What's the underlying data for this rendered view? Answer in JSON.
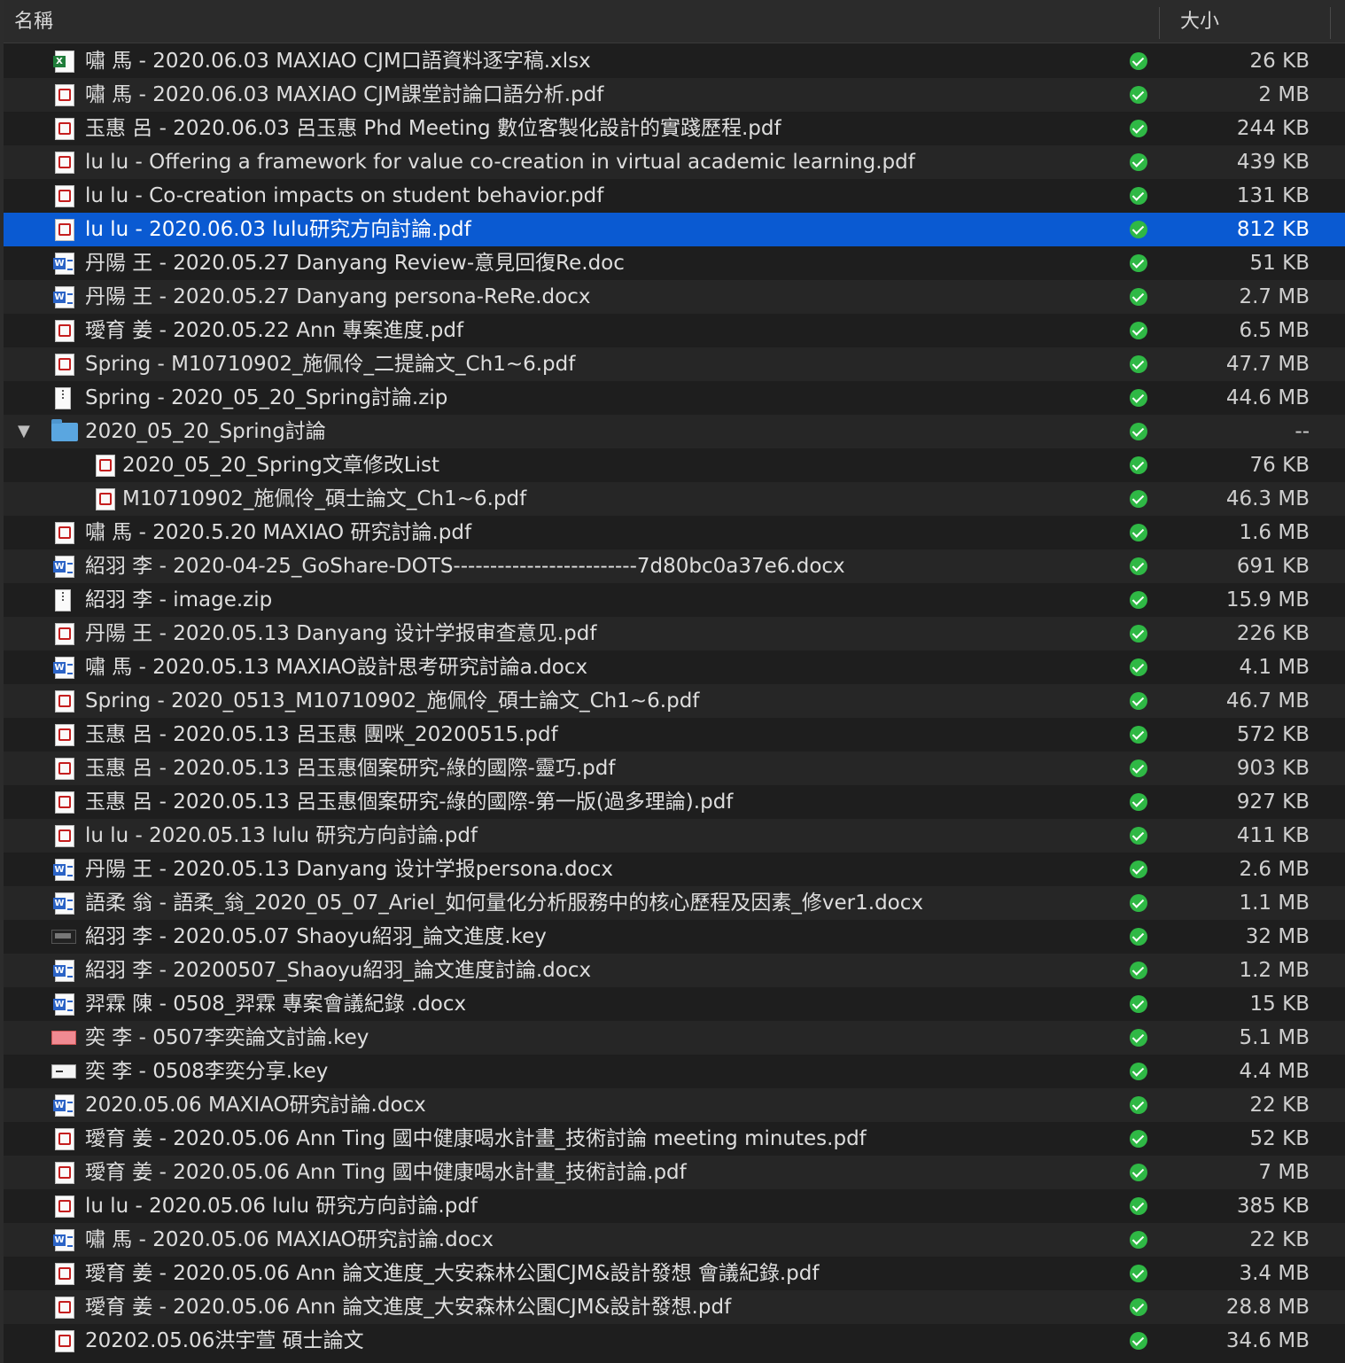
{
  "header": {
    "name_label": "名稱",
    "size_label": "大小"
  },
  "rows": [
    {
      "name": "嘯 馬 - 2020.06.03 MAXIAO CJM口語資料逐字稿.xlsx",
      "size": "26 KB",
      "icon": "xlsx-icon",
      "indent": 0
    },
    {
      "name": "嘯 馬 - 2020.06.03 MAXIAO CJM課堂討論口語分析.pdf",
      "size": "2 MB",
      "icon": "pdf-icon",
      "indent": 0
    },
    {
      "name": "玉惠 呂 - 2020.06.03 呂玉惠 Phd Meeting 數位客製化設計的實踐歷程.pdf",
      "size": "244 KB",
      "icon": "pdf-icon",
      "indent": 0
    },
    {
      "name": "lu lu - Offering a framework for value co-creation in virtual academic learning.pdf",
      "size": "439 KB",
      "icon": "pdf-icon",
      "indent": 0
    },
    {
      "name": "lu lu - Co-creation impacts on student behavior.pdf",
      "size": "131 KB",
      "icon": "pdf-icon",
      "indent": 0
    },
    {
      "name": "lu lu - 2020.06.03 lulu研究方向討論.pdf",
      "size": "812 KB",
      "icon": "pdf-icon",
      "indent": 0,
      "selected": true
    },
    {
      "name": "丹陽 王 - 2020.05.27 Danyang Review-意見回復Re.doc",
      "size": "51 KB",
      "icon": "doc-icon",
      "indent": 0
    },
    {
      "name": "丹陽 王 - 2020.05.27 Danyang persona-ReRe.docx",
      "size": "2.7 MB",
      "icon": "doc-icon",
      "indent": 0
    },
    {
      "name": "璦育 姜 - 2020.05.22 Ann 專案進度.pdf",
      "size": "6.5 MB",
      "icon": "pdf-icon",
      "indent": 0
    },
    {
      "name": "Spring  - M10710902_施佩伶_二提論文_Ch1~6.pdf",
      "size": "47.7 MB",
      "icon": "pdf-icon",
      "indent": 0
    },
    {
      "name": "Spring  - 2020_05_20_Spring討論.zip",
      "size": "44.6 MB",
      "icon": "zip-icon",
      "indent": 0
    },
    {
      "name": "2020_05_20_Spring討論",
      "size": "--",
      "icon": "folder-icon",
      "indent": 0,
      "expanded": true
    },
    {
      "name": "2020_05_20_Spring文章修改List",
      "size": "76 KB",
      "icon": "pdf-icon",
      "indent": 1
    },
    {
      "name": "M10710902_施佩伶_碩士論文_Ch1~6.pdf",
      "size": "46.3 MB",
      "icon": "pdf-icon",
      "indent": 1
    },
    {
      "name": "嘯 馬 - 2020.5.20 MAXIAO 研究討論.pdf",
      "size": "1.6 MB",
      "icon": "pdf-icon",
      "indent": 0
    },
    {
      "name": "紹羽 李 - 2020-04-25_GoShare-DOTS-------------------------7d80bc0a37e6.docx",
      "size": "691 KB",
      "icon": "doc-icon",
      "indent": 0
    },
    {
      "name": "紹羽 李 - image.zip",
      "size": "15.9 MB",
      "icon": "zip-icon",
      "indent": 0
    },
    {
      "name": "丹陽 王 - 2020.05.13 Danyang 设计学报审查意见.pdf",
      "size": "226 KB",
      "icon": "pdf-icon",
      "indent": 0
    },
    {
      "name": "嘯 馬 - 2020.05.13 MAXIAO設計思考研究討論a.docx",
      "size": "4.1 MB",
      "icon": "doc-icon",
      "indent": 0
    },
    {
      "name": "Spring  - 2020_0513_M10710902_施佩伶_碩士論文_Ch1~6.pdf",
      "size": "46.7 MB",
      "icon": "pdf-icon",
      "indent": 0
    },
    {
      "name": "玉惠 呂 - 2020.05.13 呂玉惠 團咪_20200515.pdf",
      "size": "572 KB",
      "icon": "pdf-icon",
      "indent": 0
    },
    {
      "name": "玉惠 呂 - 2020.05.13 呂玉惠個案研究-綠的國際-靈巧.pdf",
      "size": "903 KB",
      "icon": "pdf-icon",
      "indent": 0
    },
    {
      "name": "玉惠 呂 - 2020.05.13 呂玉惠個案研究-綠的國際-第一版(過多理論).pdf",
      "size": "927 KB",
      "icon": "pdf-icon",
      "indent": 0
    },
    {
      "name": "lu lu - 2020.05.13 lulu 研究方向討論.pdf",
      "size": "411 KB",
      "icon": "pdf-icon",
      "indent": 0
    },
    {
      "name": "丹陽 王 - 2020.05.13 Danyang 设计学报persona.docx",
      "size": "2.6 MB",
      "icon": "doc-icon",
      "indent": 0
    },
    {
      "name": "語柔 翁 - 語柔_翁_2020_05_07_Ariel_如何量化分析服務中的核心歷程及因素_修ver1.docx",
      "size": "1.1 MB",
      "icon": "doc-icon",
      "indent": 0
    },
    {
      "name": "紹羽 李 - 2020.05.07 Shaoyu紹羽_論文進度.key",
      "size": "32 MB",
      "icon": "keynote-dark-icon",
      "indent": 0
    },
    {
      "name": "紹羽 李 - 20200507_Shaoyu紹羽_論文進度討論.docx",
      "size": "1.2 MB",
      "icon": "doc-icon",
      "indent": 0
    },
    {
      "name": "羿霖 陳 - 0508_羿霖 專案會議紀錄 .docx",
      "size": "15 KB",
      "icon": "doc-icon",
      "indent": 0
    },
    {
      "name": "奕 李 - 0507李奕論文討論.key",
      "size": "5.1 MB",
      "icon": "keynote-pink-icon",
      "indent": 0
    },
    {
      "name": "奕 李 - 0508李奕分享.key",
      "size": "4.4 MB",
      "icon": "keynote-white-icon",
      "indent": 0
    },
    {
      "name": "2020.05.06 MAXIAO研究討論.docx",
      "size": "22 KB",
      "icon": "doc-icon",
      "indent": 0
    },
    {
      "name": "璦育 姜 - 2020.05.06 Ann Ting 國中健康喝水計畫_技術討論 meeting minutes.pdf",
      "size": "52 KB",
      "icon": "pdf-icon",
      "indent": 0
    },
    {
      "name": "璦育 姜 - 2020.05.06 Ann Ting 國中健康喝水計畫_技術討論.pdf",
      "size": "7 MB",
      "icon": "pdf-icon",
      "indent": 0
    },
    {
      "name": "lu lu - 2020.05.06 lulu 研究方向討論.pdf",
      "size": "385 KB",
      "icon": "pdf-icon",
      "indent": 0
    },
    {
      "name": "嘯 馬 - 2020.05.06 MAXIAO研究討論.docx",
      "size": "22 KB",
      "icon": "doc-icon",
      "indent": 0
    },
    {
      "name": "璦育 姜 - 2020.05.06 Ann 論文進度_大安森林公園CJM&設計發想 會議紀錄.pdf",
      "size": "3.4 MB",
      "icon": "pdf-icon",
      "indent": 0
    },
    {
      "name": "璦育 姜 - 2020.05.06 Ann 論文進度_大安森林公園CJM&設計發想.pdf",
      "size": "28.8 MB",
      "icon": "pdf-icon",
      "indent": 0
    },
    {
      "name": "20202.05.06洪宇萱 碩士論文",
      "size": "34.6 MB",
      "icon": "pdf-icon",
      "indent": 0
    }
  ],
  "colors": {
    "selection": "#0a5ad2",
    "synced": "#2fb845",
    "background": "#1e1e1e"
  }
}
